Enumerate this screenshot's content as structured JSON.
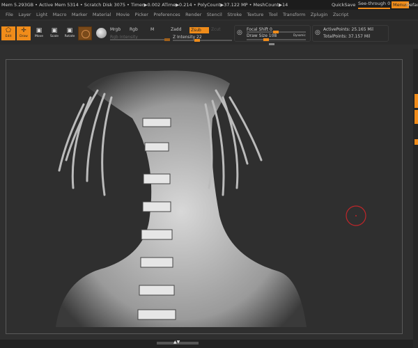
{
  "status": {
    "info": "Mem 5.293GB • Active Mem 5314 • Scratch Disk 3075 • Timer▶0.002 ATime▶0.214 • PolyCount▶37.122 MP • MeshCount▶14",
    "quicksave": "QuickSave",
    "see_through": "See-through  0",
    "menus": "Menus",
    "default": "Default"
  },
  "menu": [
    "File",
    "Layer",
    "Light",
    "Macro",
    "Marker",
    "Material",
    "Movie",
    "Picker",
    "Preferences",
    "Render",
    "Stencil",
    "Stroke",
    "Texture",
    "Tool",
    "Transform",
    "Zplugin",
    "Zscript"
  ],
  "toolbar": {
    "edit": "Edit",
    "draw": "Draw",
    "move": "Move",
    "scale": "Scale",
    "rotate": "Rotate",
    "mrgb": "Mrgb",
    "rgb": "Rgb",
    "m": "M",
    "zadd": "Zadd",
    "zsub": "Zsub",
    "zcut": "Zcut",
    "rgb_intensity": "Rgb Intensity",
    "z_intensity": "Z Intensity 22",
    "focal_shift": "Focal Shift 0",
    "draw_size": "Draw Size 108",
    "dynamic": "Dynamic",
    "active_points": "ActivePoints: 25.165 Mil",
    "total_points": "TotalPoints: 37.157 Mil"
  },
  "values": {
    "z_intensity": 22,
    "focal_shift": 0,
    "draw_size": 108
  },
  "colors": {
    "accent": "#f08c1a",
    "brush_cursor": "#c0262a"
  }
}
